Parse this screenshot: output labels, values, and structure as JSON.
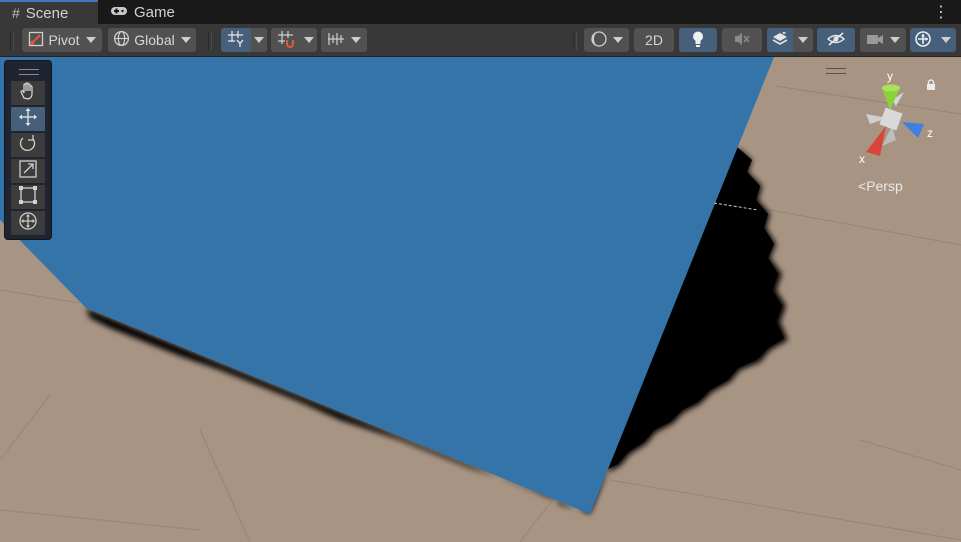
{
  "tabs": [
    {
      "label": "Scene",
      "icon": "grid-icon",
      "active": true
    },
    {
      "label": "Game",
      "icon": "gamepad-icon",
      "active": false
    }
  ],
  "toolbar": {
    "pivot_label": "Pivot",
    "global_label": "Global",
    "mode_2d_label": "2D"
  },
  "tools": [
    {
      "name": "hand-tool",
      "icon": "hand-icon",
      "selected": false
    },
    {
      "name": "move-tool",
      "icon": "move-arrows-icon",
      "selected": true
    },
    {
      "name": "rotate-tool",
      "icon": "rotate-icon",
      "selected": false
    },
    {
      "name": "scale-tool",
      "icon": "scale-icon",
      "selected": false
    },
    {
      "name": "rect-tool",
      "icon": "rect-transform-icon",
      "selected": false
    },
    {
      "name": "transform-tool",
      "icon": "transform-icon",
      "selected": false
    }
  ],
  "gizmo": {
    "x_label": "x",
    "y_label": "y",
    "z_label": "z",
    "projection_label": "Persp"
  },
  "colors": {
    "accent": "#3a79bb",
    "plane": "#3574a8",
    "ground": "#a89483",
    "toggle_on": "#46607c",
    "axis_x": "#d9453b",
    "axis_y": "#8ad13b",
    "axis_z": "#3f7fe0"
  }
}
